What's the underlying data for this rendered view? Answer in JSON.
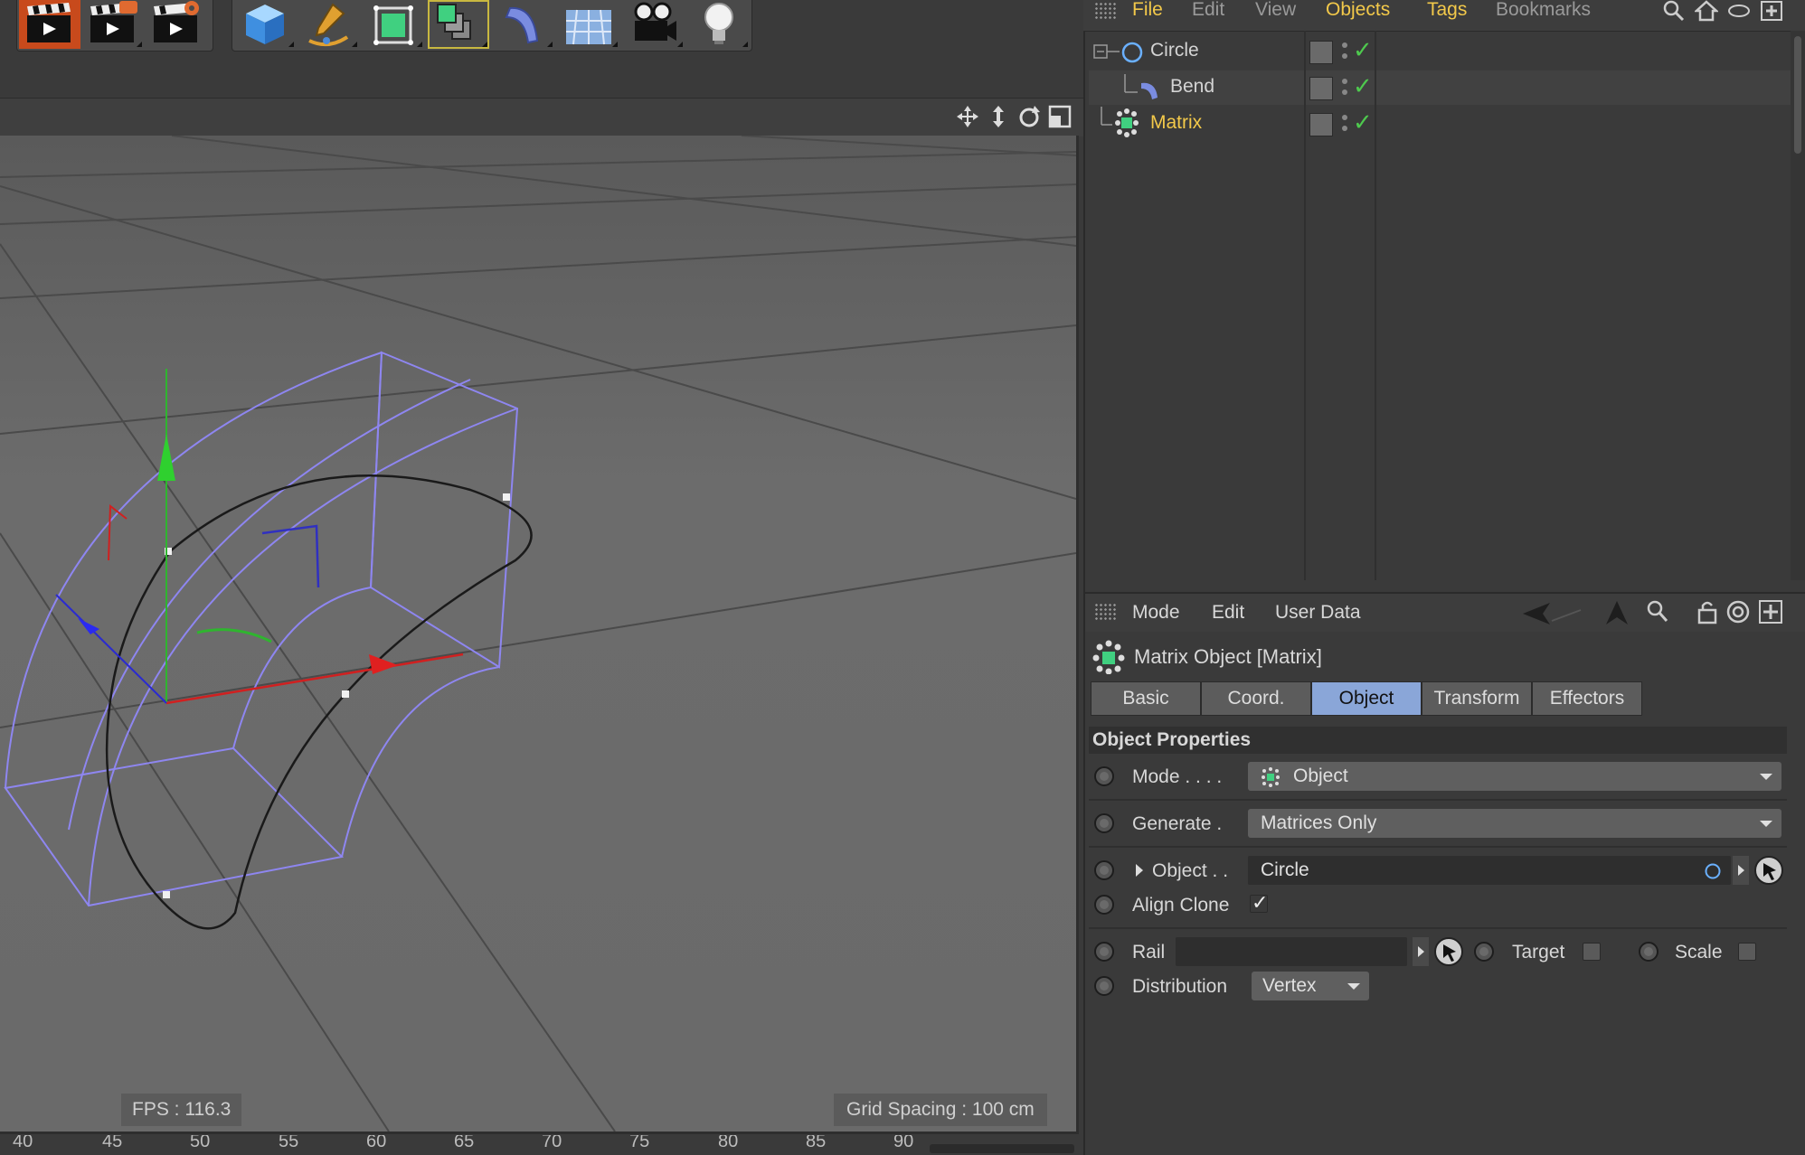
{
  "toolbar": {
    "buttons": [
      "render-view",
      "render-to-picture-viewer",
      "render-settings",
      "cube",
      "pen",
      "subdivision-surface",
      "cloner",
      "bend-deformer",
      "floor",
      "camera",
      "light"
    ]
  },
  "object_manager": {
    "menu": [
      "File",
      "Edit",
      "View",
      "Objects",
      "Tags",
      "Bookmarks"
    ],
    "objects": [
      {
        "name": "Circle",
        "icon": "circle-spline-icon",
        "selected": false
      },
      {
        "name": "Bend",
        "icon": "bend-deformer-icon",
        "selected": false
      },
      {
        "name": "Matrix",
        "icon": "matrix-object-icon",
        "selected": true
      }
    ],
    "status_check": "✓"
  },
  "viewport": {
    "fps": "FPS : 116.3",
    "grid_spacing": "Grid Spacing : 100 cm"
  },
  "timeline": {
    "ticks": [
      "40",
      "45",
      "50",
      "55",
      "60",
      "65",
      "70",
      "75",
      "80",
      "85",
      "90"
    ]
  },
  "attributes": {
    "menu": [
      "Mode",
      "Edit",
      "User Data"
    ],
    "title": "Matrix Object [Matrix]",
    "tabs": [
      "Basic",
      "Coord.",
      "Object",
      "Transform",
      "Effectors"
    ],
    "active_tab": "Object",
    "section": "Object Properties",
    "mode": {
      "label": "Mode . . . .",
      "value": "Object"
    },
    "generate": {
      "label": "Generate .",
      "value": "Matrices Only"
    },
    "object": {
      "label": "Object . .",
      "value": "Circle"
    },
    "align_clone": {
      "label": "Align Clone",
      "checked": true,
      "check": "✓"
    },
    "rail": {
      "label": "Rail",
      "value": ""
    },
    "target": {
      "label": "Target",
      "checked": false
    },
    "scale": {
      "label": "Scale",
      "checked": false
    },
    "distribution": {
      "label": "Distribution",
      "value": "Vertex"
    }
  },
  "colors": {
    "accent_yellow": "#f3c94a",
    "tab_active": "#8aa6d8",
    "check_green": "#4ec94e",
    "spline_purple": "#8e86f0"
  }
}
